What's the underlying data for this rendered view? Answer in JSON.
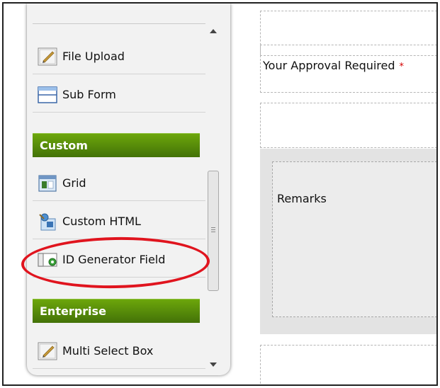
{
  "palette": {
    "items_top": [
      {
        "label": "File Upload",
        "icon": "file-upload-icon"
      },
      {
        "label": "Sub Form",
        "icon": "sub-form-icon"
      }
    ],
    "categories": [
      {
        "label": "Custom"
      },
      {
        "label": "Enterprise"
      }
    ],
    "custom_items": [
      {
        "label": "Grid",
        "icon": "grid-icon"
      },
      {
        "label": "Custom HTML",
        "icon": "custom-html-icon"
      },
      {
        "label": "ID Generator Field",
        "icon": "id-generator-icon"
      }
    ],
    "enterprise_items": [
      {
        "label": "Multi Select Box",
        "icon": "multi-select-icon"
      }
    ]
  },
  "form": {
    "approval_label": "Your Approval Required",
    "required_marker": "*",
    "remarks_label": "Remarks"
  },
  "colors": {
    "category_green_top": "#6ca60b",
    "category_green_bottom": "#437208",
    "highlight_red": "#e0141e"
  }
}
